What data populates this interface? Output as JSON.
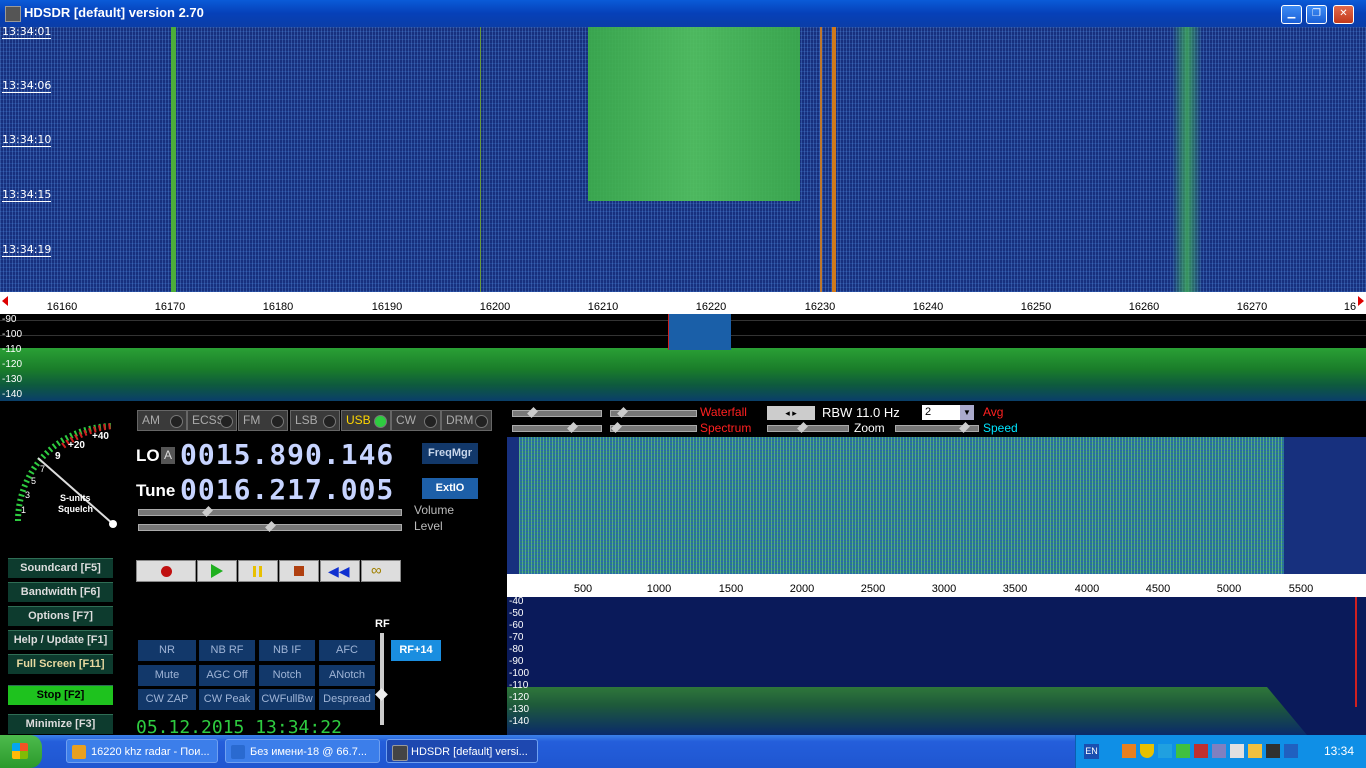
{
  "window": {
    "title": "HDSDR [default]  version 2.70"
  },
  "waterfall": {
    "timestamps": [
      "13:34:01",
      "13:34:06",
      "13:34:10",
      "13:34:15",
      "13:34:19"
    ]
  },
  "freq_scale": {
    "labels": [
      "16160",
      "16170",
      "16180",
      "16190",
      "16200",
      "16210",
      "16220",
      "16230",
      "16240",
      "16250",
      "16260",
      "16270",
      "16"
    ]
  },
  "spectrum": {
    "db_labels": [
      "-90",
      "-100",
      "-110",
      "-120",
      "-130",
      "-140"
    ]
  },
  "modes": [
    {
      "label": "AM",
      "active": false
    },
    {
      "label": "ECSS",
      "active": false
    },
    {
      "label": "FM",
      "active": false
    },
    {
      "label": "LSB",
      "active": false
    },
    {
      "label": "USB",
      "active": true
    },
    {
      "label": "CW",
      "active": false
    },
    {
      "label": "DRM",
      "active": false
    }
  ],
  "smeter": {
    "scale_labels": [
      "+40",
      "+20",
      "9",
      "7",
      "5",
      "3",
      "1"
    ],
    "caption1": "S-units",
    "caption2": "Squelch"
  },
  "lo": {
    "label": "LO",
    "badge": "A",
    "value": "0015.890.146"
  },
  "tune": {
    "label": "Tune",
    "value": "0016.217.005"
  },
  "buttons": {
    "freqmgr": "FreqMgr",
    "extio": "ExtIO",
    "rf_gain": "RF+14",
    "rf_label": "RF"
  },
  "sliders": {
    "volume_label": "Volume",
    "level_label": "Level"
  },
  "side_buttons": [
    {
      "label": "Soundcard  [F5]"
    },
    {
      "label": "Bandwidth  [F6]"
    },
    {
      "label": "Options  [F7]"
    },
    {
      "label": "Help / Update  [F1]"
    },
    {
      "label": "Full Screen  [F11]"
    },
    {
      "label": "Stop        [F2]"
    },
    {
      "label": "Minimize  [F3]"
    }
  ],
  "function_buttons": [
    [
      "NR",
      "NB RF",
      "NB IF",
      "AFC"
    ],
    [
      "Mute",
      "AGC Off",
      "Notch",
      "ANotch"
    ],
    [
      "CW ZAP",
      "CW Peak",
      "CWFullBw",
      "Despread"
    ]
  ],
  "datetime": "05.12.2015 13:34:22",
  "audio_controls": {
    "waterfall_label": "Waterfall",
    "spectrum_label": "Spectrum",
    "rbw": "RBW 11.0 Hz",
    "avg_value": "2",
    "avg_label": "Avg",
    "zoom_label": "Zoom",
    "speed_label": "Speed"
  },
  "audio_scale": {
    "labels": [
      "500",
      "1000",
      "1500",
      "2000",
      "2500",
      "3000",
      "3500",
      "4000",
      "4500",
      "5000",
      "5500"
    ]
  },
  "audio_spectrum": {
    "db_labels": [
      "-40",
      "-50",
      "-60",
      "-70",
      "-80",
      "-90",
      "-100",
      "-110",
      "-120",
      "-130",
      "-140"
    ]
  },
  "taskbar": {
    "tasks": [
      {
        "label": "16220 khz radar - Пои...",
        "color": "#e8a020"
      },
      {
        "label": "Без имени-18 @ 66.7...",
        "color": "#2a6ad0"
      },
      {
        "label": "HDSDR [default]  versi...",
        "color": "#444"
      }
    ],
    "lang": "EN",
    "clock": "13:34"
  },
  "colors": {
    "waterfall_bg": "#17307e",
    "signal_green": "#2fbf3a",
    "active_mode": "#ffd700",
    "stop_button": "#1ec21e"
  }
}
